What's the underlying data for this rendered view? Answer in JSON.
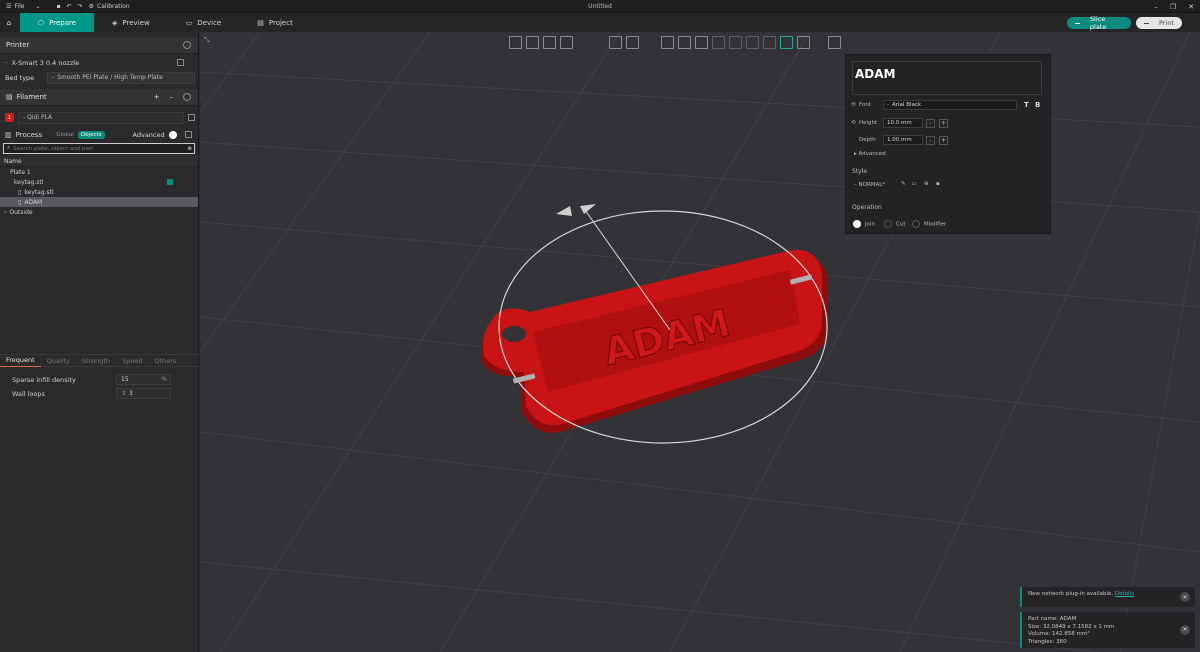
{
  "titlebar": {
    "file_label": "File",
    "calibration_label": "Calibration",
    "window_title": "Untitled"
  },
  "nav": {
    "tabs": [
      {
        "label": "Prepare"
      },
      {
        "label": "Preview"
      },
      {
        "label": "Device"
      },
      {
        "label": "Project"
      }
    ],
    "slice_label": "Slice plate",
    "print_label": "Print"
  },
  "sidebar": {
    "printer_title": "Printer",
    "printer_name": "X-Smart 3 0.4 nozzle",
    "bed_type_label": "Bed type",
    "bed_type_value": "Smooth PEI Plate / High Temp Plate",
    "filament_title": "Filament",
    "filament_index": "1",
    "filament_name": "Qidi PLA",
    "process_title": "Process",
    "process_global": "Global",
    "process_objects": "Objects",
    "advanced_label": "Advanced",
    "search_placeholder": "Search plate, object and part",
    "name_header": "Name",
    "tree": [
      "Plate 1",
      "keytag.stl",
      "keytag.stl",
      "ADAM",
      "Outside"
    ],
    "param_tabs": [
      "Frequent",
      "Quality",
      "Strength",
      "Speed",
      "Others"
    ],
    "params": [
      {
        "label": "Sparse infill density",
        "value": "15",
        "unit": "%"
      },
      {
        "label": "Wall loops",
        "value": "3",
        "unit": ""
      }
    ]
  },
  "text_panel": {
    "text_value": "ADAM",
    "font_label": "Font",
    "font_value": "Arial Black",
    "height_label": "Height",
    "height_value": "10.0 mm",
    "depth_label": "Depth",
    "depth_value": "1.00 mm",
    "advanced_label": "Advanced",
    "style_label": "Style",
    "style_value": "NORMAL*",
    "operation_label": "Operation",
    "op_join": "Join",
    "op_cut": "Cut",
    "op_modifier": "Modifier"
  },
  "model": {
    "embossed_text": "ADAM"
  },
  "notifications": {
    "plugin_text": "New network plug-in available.",
    "plugin_link": "Details",
    "part_name": "Part name: ADAM",
    "size": "Size: 32.0849 x 7.1582 x 1 mm",
    "volume": "Volume: 142.858 mm³",
    "triangles": "Triangles: 360"
  },
  "colors": {
    "accent": "#009688",
    "model_red": "#c81414"
  }
}
